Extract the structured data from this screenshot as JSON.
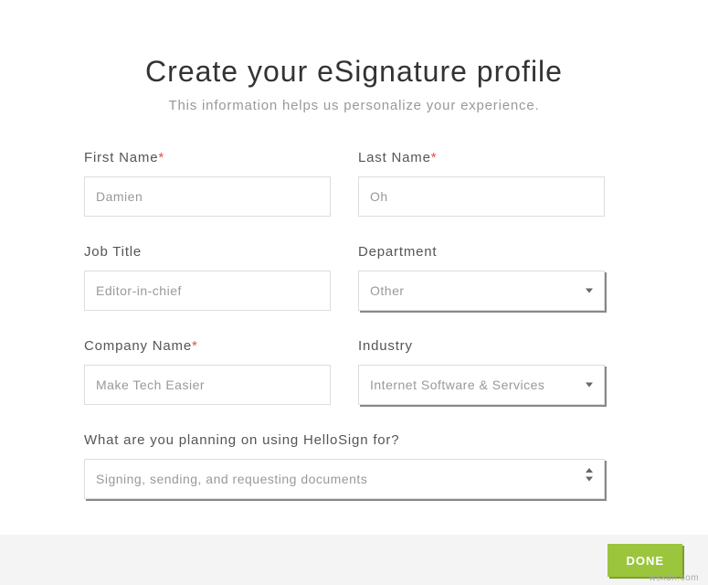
{
  "header": {
    "title": "Create your eSignature profile",
    "subtitle": "This information helps us personalize your experience."
  },
  "fields": {
    "firstName": {
      "label": "First Name",
      "required": "*",
      "value": "Damien"
    },
    "lastName": {
      "label": "Last Name",
      "required": "*",
      "value": "Oh"
    },
    "jobTitle": {
      "label": "Job Title",
      "value": "Editor-in-chief"
    },
    "department": {
      "label": "Department",
      "value": "Other"
    },
    "company": {
      "label": "Company Name",
      "required": "*",
      "value": "Make Tech Easier"
    },
    "industry": {
      "label": "Industry",
      "value": "Internet Software & Services"
    },
    "usage": {
      "label": "What are you planning on using HelloSign for?",
      "value": "Signing, sending, and requesting documents"
    }
  },
  "footer": {
    "doneLabel": "DONE"
  },
  "watermark": "wsxdn.com"
}
